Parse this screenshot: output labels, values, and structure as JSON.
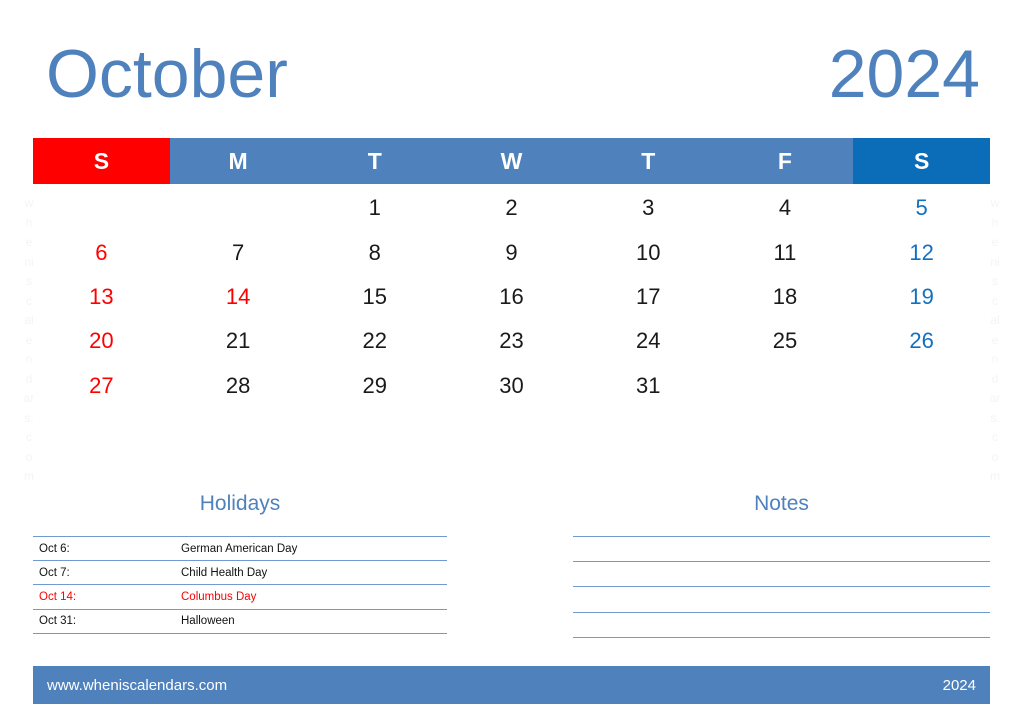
{
  "header": {
    "month": "October",
    "year": "2024"
  },
  "watermark": {
    "chars": [
      "w",
      "h",
      "e",
      "ni",
      "s",
      "c",
      "al",
      "e",
      "n",
      "d",
      "ar",
      "s.",
      "c",
      "o",
      "m"
    ],
    "text": "wheniscalendars.com"
  },
  "calendar": {
    "weekday_headers": [
      {
        "label": "S",
        "kind": "sun"
      },
      {
        "label": "M",
        "kind": "weekday"
      },
      {
        "label": "T",
        "kind": "weekday"
      },
      {
        "label": "W",
        "kind": "weekday"
      },
      {
        "label": "T",
        "kind": "weekday"
      },
      {
        "label": "F",
        "kind": "weekday"
      },
      {
        "label": "S",
        "kind": "sat"
      }
    ],
    "weeks": [
      [
        {
          "day": "",
          "kind": "empty"
        },
        {
          "day": "",
          "kind": "empty"
        },
        {
          "day": "1",
          "kind": "weekday"
        },
        {
          "day": "2",
          "kind": "weekday"
        },
        {
          "day": "3",
          "kind": "weekday"
        },
        {
          "day": "4",
          "kind": "weekday"
        },
        {
          "day": "5",
          "kind": "sat"
        }
      ],
      [
        {
          "day": "6",
          "kind": "sun"
        },
        {
          "day": "7",
          "kind": "weekday"
        },
        {
          "day": "8",
          "kind": "weekday"
        },
        {
          "day": "9",
          "kind": "weekday"
        },
        {
          "day": "10",
          "kind": "weekday"
        },
        {
          "day": "11",
          "kind": "weekday"
        },
        {
          "day": "12",
          "kind": "sat"
        }
      ],
      [
        {
          "day": "13",
          "kind": "sun"
        },
        {
          "day": "14",
          "kind": "hol"
        },
        {
          "day": "15",
          "kind": "weekday"
        },
        {
          "day": "16",
          "kind": "weekday"
        },
        {
          "day": "17",
          "kind": "weekday"
        },
        {
          "day": "18",
          "kind": "weekday"
        },
        {
          "day": "19",
          "kind": "sat"
        }
      ],
      [
        {
          "day": "20",
          "kind": "sun"
        },
        {
          "day": "21",
          "kind": "weekday"
        },
        {
          "day": "22",
          "kind": "weekday"
        },
        {
          "day": "23",
          "kind": "weekday"
        },
        {
          "day": "24",
          "kind": "weekday"
        },
        {
          "day": "25",
          "kind": "weekday"
        },
        {
          "day": "26",
          "kind": "sat"
        }
      ],
      [
        {
          "day": "27",
          "kind": "sun"
        },
        {
          "day": "28",
          "kind": "weekday"
        },
        {
          "day": "29",
          "kind": "weekday"
        },
        {
          "day": "30",
          "kind": "weekday"
        },
        {
          "day": "31",
          "kind": "weekday"
        },
        {
          "day": "",
          "kind": "empty"
        },
        {
          "day": "",
          "kind": "empty"
        }
      ]
    ]
  },
  "holidays": {
    "heading": "Holidays",
    "rows": [
      {
        "date": "Oct 6:",
        "name": "German American Day",
        "highlight": false
      },
      {
        "date": "Oct 7:",
        "name": "Child Health Day",
        "highlight": false
      },
      {
        "date": "Oct 14:",
        "name": "Columbus Day",
        "highlight": true
      },
      {
        "date": "Oct 31:",
        "name": "Halloween",
        "highlight": false
      }
    ]
  },
  "notes": {
    "heading": "Notes",
    "line_count": 5
  },
  "footer": {
    "website": "www.wheniscalendars.com",
    "year": "2024"
  },
  "colors": {
    "brand_blue": "#4f81bd",
    "sunday_red": "#fe0000",
    "saturday_blue": "#0b6cb8",
    "saturday_text": "#1270c1",
    "rule_blue": "#6f9bd1",
    "watermark": "#f2f4f7"
  }
}
